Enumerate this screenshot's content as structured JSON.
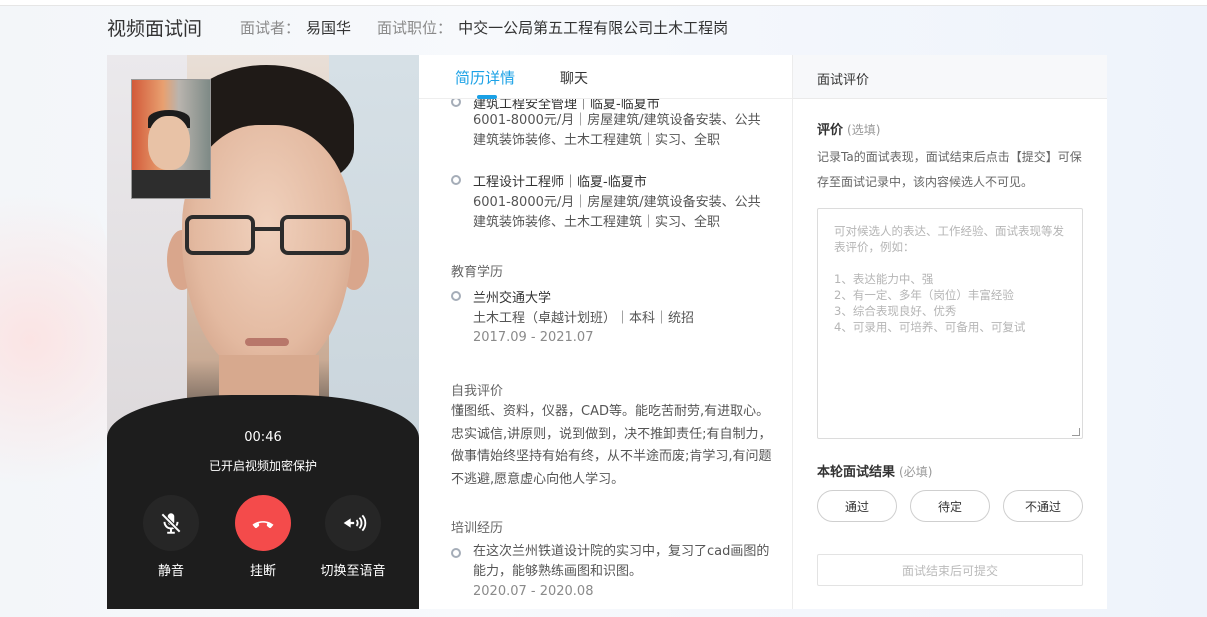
{
  "header": {
    "title": "视频面试间",
    "interviewer_label": "面试者：",
    "interviewer_name": "易国华",
    "position_label": "面试职位：",
    "position_value": "中交一公局第五工程有限公司土木工程岗"
  },
  "video": {
    "timer": "00:46",
    "encryption_text": "已开启视频加密保护",
    "controls": {
      "mute": "静音",
      "hangup": "挂断",
      "switch_voice": "切换至语音"
    }
  },
  "resume": {
    "tabs": {
      "resume": "简历详情",
      "chat": "聊天"
    },
    "jobs": [
      {
        "title": "建筑工程安全管理｜临夏-临夏市",
        "desc": "6001-8000元/月｜房屋建筑/建筑设备安装、公共建筑装饰装修、土木工程建筑｜实习、全职"
      },
      {
        "title": "工程设计工程师｜临夏-临夏市",
        "desc": "6001-8000元/月｜房屋建筑/建筑设备安装、公共建筑装饰装修、土木工程建筑｜实习、全职"
      }
    ],
    "education": {
      "section_title": "教育学历",
      "school": "兰州交通大学",
      "major": "土木工程（卓越计划班）｜本科｜统招",
      "date": "2017.09 - 2021.07"
    },
    "self_eval": {
      "section_title": "自我评价",
      "text": "懂图纸、资料，仪器，CAD等。能吃苦耐劳,有进取心。忠实诚信,讲原则，说到做到，决不推卸责任;有自制力，做事情始终坚持有始有终，从不半途而废;肯学习,有问题不逃避,愿意虚心向他人学习。"
    },
    "training": {
      "section_title": "培训经历",
      "text": "在这次兰州铁道设计院的实习中，复习了cad画图的能力，能够熟练画图和识图。",
      "date": "2020.07 - 2020.08"
    }
  },
  "evaluation": {
    "header": "面试评价",
    "label": "评价",
    "optional": "(选填)",
    "note": "记录Ta的面试表现，面试结束后点击【提交】可保存至面试记录中，该内容候选人不可见。",
    "placeholder": "可对候选人的表达、工作经验、面试表现等发表评价，例如：\n\n1、表达能力中、强\n2、有一定、多年（岗位）丰富经验\n3、综合表现良好、优秀\n4、可录用、可培养、可备用、可复试",
    "result_label": "本轮面试结果",
    "required": "(必填)",
    "buttons": {
      "pass": "通过",
      "pending": "待定",
      "fail": "不通过"
    },
    "submit": "面试结束后可提交"
  }
}
